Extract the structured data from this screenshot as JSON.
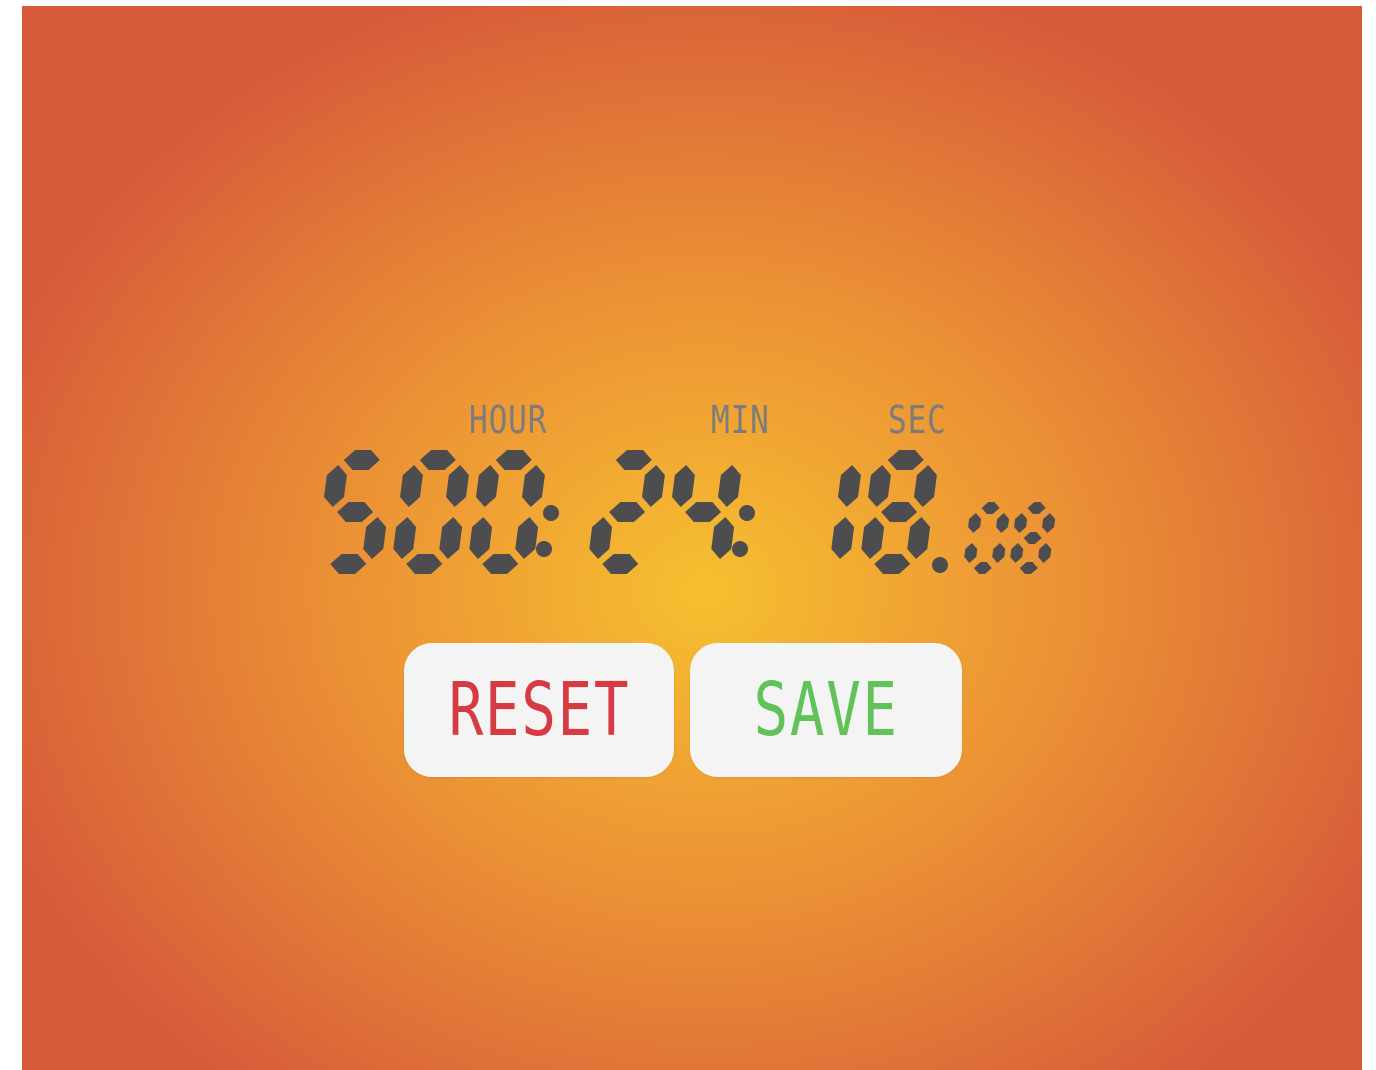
{
  "timer": {
    "hours": "500",
    "minutes": "24",
    "seconds": "18",
    "hundredths": "08",
    "display": "500:24:18.08"
  },
  "labels": {
    "hour": "HOUR",
    "min": "MIN",
    "sec": "SEC"
  },
  "buttons": {
    "reset": "RESET",
    "save": "SAVE"
  },
  "colors": {
    "segment": "#4d4d4f",
    "label": "#7c7c7c",
    "reset": "#d63a43",
    "save": "#62c25a",
    "button_bg": "#f4f4f4",
    "bg_center": "#f6c030",
    "bg_edge": "#d65a3a"
  }
}
